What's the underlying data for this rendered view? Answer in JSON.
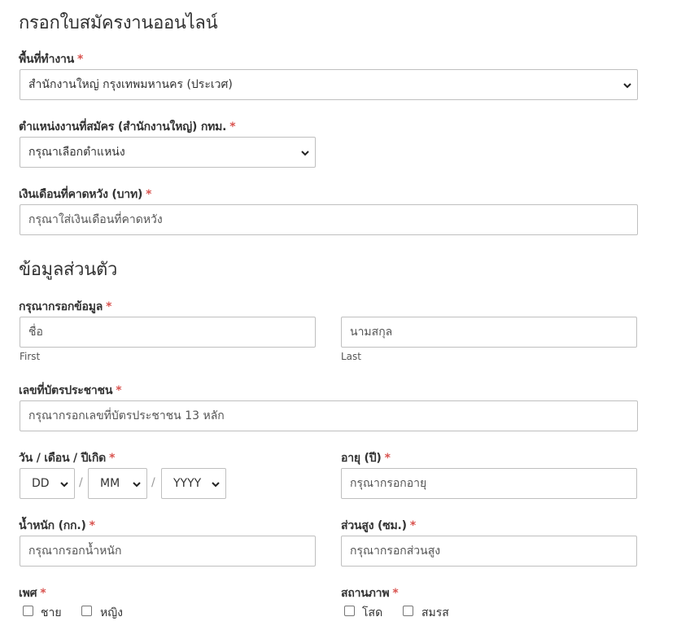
{
  "form": {
    "title": "กรอกใบสมัครงานออนไลน์",
    "required_mark": "*",
    "area": {
      "label": "พื้นที่ทำงาน",
      "selected": "สำนักงานใหญ่ กรุงเทพมหานคร (ประเวศ)"
    },
    "position": {
      "label": "ตำแหน่งงานที่สมัคร (สำนักงานใหญ่) กทม.",
      "selected": "กรุณาเลือกตำแหน่ง"
    },
    "salary": {
      "label": "เงินเดือนที่คาดหวัง (บาท)",
      "placeholder": "กรุณาใส่เงินเดือนที่คาดหวัง"
    }
  },
  "personal": {
    "title": "ข้อมูลส่วนตัว",
    "name": {
      "label": "กรุณากรอกข้อมูล",
      "first_placeholder": "ชื่อ",
      "first_sub": "First",
      "last_placeholder": "นามสกุล",
      "last_sub": "Last"
    },
    "id_card": {
      "label": "เลขที่บัตรประชาชน",
      "placeholder": "กรุณากรอกเลขที่บัตรประชาชน 13 หลัก"
    },
    "birth": {
      "label": "วัน / เดือน / ปีเกิด",
      "day": "DD",
      "month": "MM",
      "year": "YYYY",
      "separator": "/"
    },
    "age": {
      "label": "อายุ (ปี)",
      "placeholder": "กรุณากรอกอายุ"
    },
    "weight": {
      "label": "น้ำหนัก (กก.)",
      "placeholder": "กรุณากรอกน้ำหนัก"
    },
    "height": {
      "label": "ส่วนสูง (ซม.)",
      "placeholder": "กรุณากรอกส่วนสูง"
    },
    "gender": {
      "label": "เพศ",
      "options": [
        "ชาย",
        "หญิง"
      ]
    },
    "status": {
      "label": "สถานภาพ",
      "options": [
        "โสด",
        "สมรส"
      ]
    }
  },
  "colors": {
    "required": "#d9534f",
    "border": "#bfbfbf",
    "text": "#333333"
  }
}
